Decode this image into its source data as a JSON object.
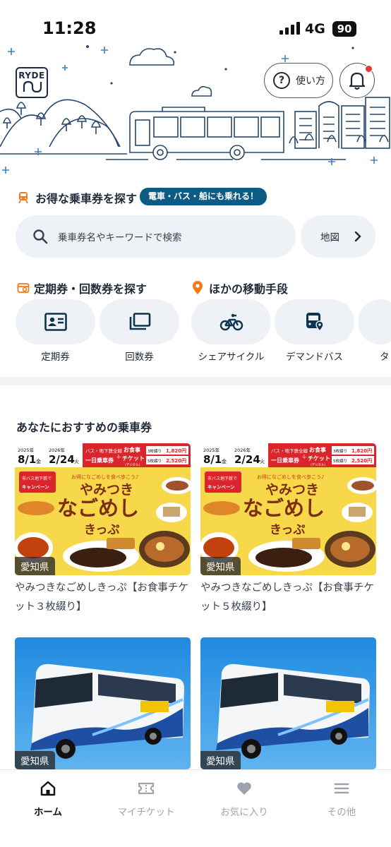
{
  "status_bar": {
    "time": "11:28",
    "network": "4G",
    "battery": "90"
  },
  "hero": {
    "logo_text": "RYDE",
    "help_label": "使い方",
    "bell_icon": "bell-icon",
    "notification_color": "#e53935"
  },
  "ticket_search": {
    "title": "お得な乗車券を探す",
    "tag": "電車・バス・船にも乗れる！",
    "search_placeholder": "乗車券名やキーワードで検索",
    "map_label": "地図"
  },
  "passes": {
    "title": "定期券・回数券を探す",
    "items": [
      {
        "label": "定期券",
        "icon": "id-card-icon"
      },
      {
        "label": "回数券",
        "icon": "stacked-tickets-icon"
      }
    ]
  },
  "mobility": {
    "title": "ほかの移動手段",
    "items": [
      {
        "label": "シェアサイクル",
        "icon": "bicycle-icon"
      },
      {
        "label": "デマンドバス",
        "icon": "bus-pin-icon"
      },
      {
        "label": "タ",
        "icon": "taxi-icon"
      }
    ]
  },
  "recommended": {
    "title": "あなたにおすすめの乗車券",
    "cards": [
      {
        "prefecture": "愛知県",
        "title": "やみつきなごめしきっぷ【お食事チケット３枚綴り】",
        "banner": {
          "start_year": "2025年",
          "start": "8/1",
          "start_dow": "金",
          "end_year": "2026年",
          "end": "2/24",
          "end_dow": "火",
          "line1": "バス・地下鉄全線",
          "line2": "一日乗車券",
          "plus": "＋",
          "meal1": "お食事",
          "meal2": "チケット",
          "digital": "(デジタル)",
          "p1_label": "3枚綴り",
          "p1": "1,820円",
          "p2_label": "5枚綴り",
          "p2": "2,520円",
          "campaign": "市バス地下鉄で",
          "campaign2": "キャンペーン",
          "catch": "お得になごめしを食べ歩こう♪",
          "brand1": "やみつき",
          "brand2": "なごめし",
          "brand3": "きっぷ"
        }
      },
      {
        "prefecture": "愛知県",
        "title": "やみつきなごめしきっぷ【お食事チケット５枚綴り】",
        "banner": {
          "start_year": "2025年",
          "start": "8/1",
          "start_dow": "金",
          "end_year": "2026年",
          "end": "2/24",
          "end_dow": "火",
          "line1": "バス・地下鉄全線",
          "line2": "一日乗車券",
          "plus": "＋",
          "meal1": "お食事",
          "meal2": "チケット",
          "digital": "(デジタル)",
          "p1_label": "3枚綴り",
          "p1": "1,820円",
          "p2_label": "5枚綴り",
          "p2": "2,520円",
          "campaign": "市バス地下鉄で",
          "campaign2": "キャンペーン",
          "catch": "お得になごめしを食べ歩こう♪",
          "brand1": "やみつき",
          "brand2": "なごめし",
          "brand3": "きっぷ"
        }
      },
      {
        "prefecture": "愛知県"
      },
      {
        "prefecture": "愛知県"
      }
    ]
  },
  "bottom_nav": [
    {
      "label": "ホーム",
      "icon": "home-icon",
      "active": true
    },
    {
      "label": "マイチケット",
      "icon": "ticket-icon",
      "active": false
    },
    {
      "label": "お気に入り",
      "icon": "heart-icon",
      "active": false
    },
    {
      "label": "その他",
      "icon": "menu-icon",
      "active": false
    }
  ],
  "colors": {
    "accent_orange": "#f07a1a",
    "navy": "#0d5a84",
    "pill_bg": "#eef2f6"
  }
}
